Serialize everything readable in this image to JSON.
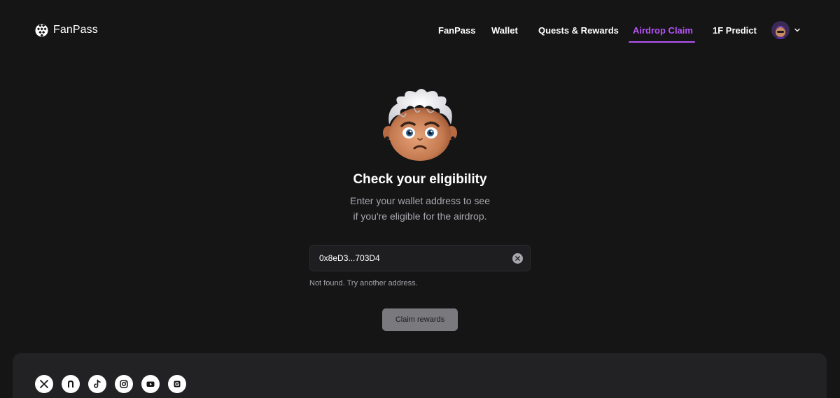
{
  "header": {
    "logo_text": "FanPass",
    "nav": [
      {
        "label": "FanPass",
        "active": false
      },
      {
        "label": "Wallet",
        "active": false
      },
      {
        "label": "Quests & Rewards",
        "active": false
      },
      {
        "label": "Airdrop Claim",
        "active": true
      },
      {
        "label": "1F Predict",
        "active": false
      }
    ]
  },
  "main": {
    "title": "Check your eligibility",
    "subtitle_line1": "Enter your wallet address to see",
    "subtitle_line2": "if you're eligible for the airdrop.",
    "input_value": "0x8eD3...703D4",
    "error": "Not found. Try another address.",
    "claim_label": "Claim rewards"
  },
  "footer": {
    "socials": [
      "x-icon",
      "nostr-icon",
      "tiktok-icon",
      "instagram-icon",
      "youtube-icon",
      "guild-icon"
    ]
  },
  "colors": {
    "background": "#151516",
    "accent": "#b553f5",
    "footer_bg": "#222224",
    "button_bg": "#7a7a7e"
  }
}
